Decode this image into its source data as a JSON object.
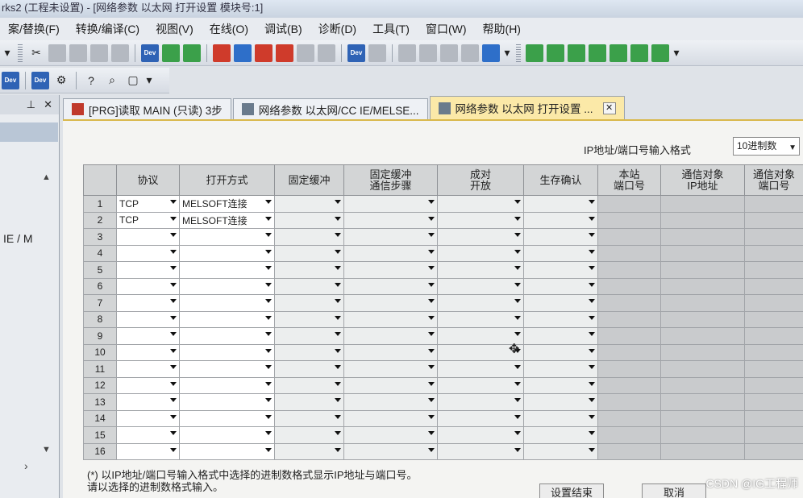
{
  "window": {
    "title": "rks2 (工程未设置) - [网络参数 以太网 打开设置 模块号:1]"
  },
  "menu": [
    "案/替换(F)",
    "转换/编译(C)",
    "视图(V)",
    "在线(O)",
    "调试(B)",
    "诊断(D)",
    "工具(T)",
    "窗口(W)",
    "帮助(H)"
  ],
  "toolbar": {
    "dev_label": "Dev"
  },
  "left_panel": {
    "pin": "⊥",
    "close": "✕",
    "text": "IE / M",
    "up": "▲",
    "down": "▼",
    "right": "›"
  },
  "tabs": [
    {
      "label": "[PRG]读取 MAIN (只读) 3步",
      "active": false
    },
    {
      "label": "网络参数 以太网/CC IE/MELSE...",
      "active": false
    },
    {
      "label": "网络参数 以太网 打开设置 ...",
      "active": true
    }
  ],
  "tab_close": "✕",
  "format": {
    "label": "IP地址/端口号输入格式",
    "value": "10进制数"
  },
  "table": {
    "headers": [
      {
        "l1": "协议",
        "l2": ""
      },
      {
        "l1": "打开方式",
        "l2": ""
      },
      {
        "l1": "固定缓冲",
        "l2": ""
      },
      {
        "l1": "固定缓冲",
        "l2": "通信步骤"
      },
      {
        "l1": "成对",
        "l2": "开放"
      },
      {
        "l1": "生存确认",
        "l2": ""
      },
      {
        "l1": "本站",
        "l2": "端口号"
      },
      {
        "l1": "通信对象",
        "l2": "IP地址"
      },
      {
        "l1": "通信对象",
        "l2": "端口号"
      }
    ],
    "rows": [
      {
        "n": "1",
        "protocol": "TCP",
        "open_method": "MELSOFT连接"
      },
      {
        "n": "2",
        "protocol": "TCP",
        "open_method": "MELSOFT连接"
      },
      {
        "n": "3",
        "protocol": "",
        "open_method": ""
      },
      {
        "n": "4",
        "protocol": "",
        "open_method": ""
      },
      {
        "n": "5",
        "protocol": "",
        "open_method": ""
      },
      {
        "n": "6",
        "protocol": "",
        "open_method": ""
      },
      {
        "n": "7",
        "protocol": "",
        "open_method": ""
      },
      {
        "n": "8",
        "protocol": "",
        "open_method": ""
      },
      {
        "n": "9",
        "protocol": "",
        "open_method": ""
      },
      {
        "n": "10",
        "protocol": "",
        "open_method": ""
      },
      {
        "n": "11",
        "protocol": "",
        "open_method": ""
      },
      {
        "n": "12",
        "protocol": "",
        "open_method": ""
      },
      {
        "n": "13",
        "protocol": "",
        "open_method": ""
      },
      {
        "n": "14",
        "protocol": "",
        "open_method": ""
      },
      {
        "n": "15",
        "protocol": "",
        "open_method": ""
      },
      {
        "n": "16",
        "protocol": "",
        "open_method": ""
      }
    ]
  },
  "footnote": {
    "line1": "(*) 以IP地址/端口号输入格式中选择的进制数格式显示IP地址与端口号。",
    "line2": "请以选择的进制数格式输入。"
  },
  "buttons": {
    "finish": "设置结束",
    "cancel": "取消"
  },
  "watermark": "CSDN @IG工程师"
}
